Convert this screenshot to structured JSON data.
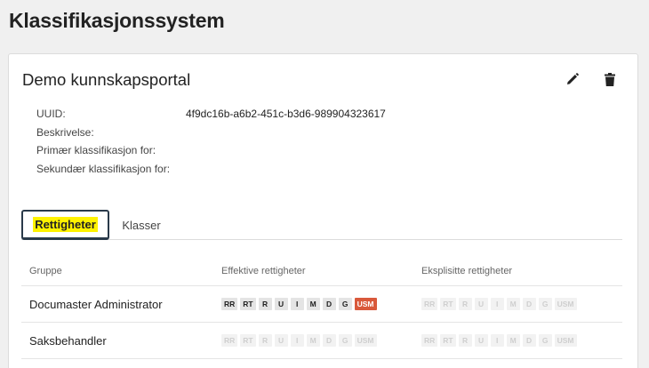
{
  "page": {
    "title": "Klassifikasjonssystem"
  },
  "card": {
    "title": "Demo kunnskapsportal",
    "edit_icon": "pencil-icon",
    "delete_icon": "trash-icon",
    "meta": [
      {
        "label": "UUID:",
        "value": "4f9dc16b-a6b2-451c-b3d6-989904323617"
      },
      {
        "label": "Beskrivelse:",
        "value": ""
      },
      {
        "label": "Primær klassifikasjon for:",
        "value": ""
      },
      {
        "label": "Sekundær klassifikasjon for:",
        "value": ""
      }
    ]
  },
  "tabs": [
    {
      "label": "Rettigheter",
      "active": true
    },
    {
      "label": "Klasser",
      "active": false
    }
  ],
  "permissions": {
    "headers": [
      "Gruppe",
      "Effektive rettigheter",
      "Eksplisitte rettigheter"
    ],
    "chip_labels": [
      "RR",
      "RT",
      "R",
      "U",
      "I",
      "M",
      "D",
      "G",
      "USM"
    ],
    "rows": [
      {
        "group": "Documaster Administrator",
        "effective": [
          true,
          true,
          true,
          true,
          true,
          true,
          true,
          true,
          true
        ],
        "explicit": [
          false,
          false,
          false,
          false,
          false,
          false,
          false,
          false,
          false
        ]
      },
      {
        "group": "Saksbehandler",
        "effective": [
          false,
          false,
          false,
          false,
          false,
          false,
          false,
          false,
          false
        ],
        "explicit": [
          false,
          false,
          false,
          false,
          false,
          false,
          false,
          false,
          false
        ]
      }
    ]
  },
  "colors": {
    "highlight": "#fff200",
    "usm_active": "#d9593b",
    "tab_border": "#2a3a4a"
  }
}
